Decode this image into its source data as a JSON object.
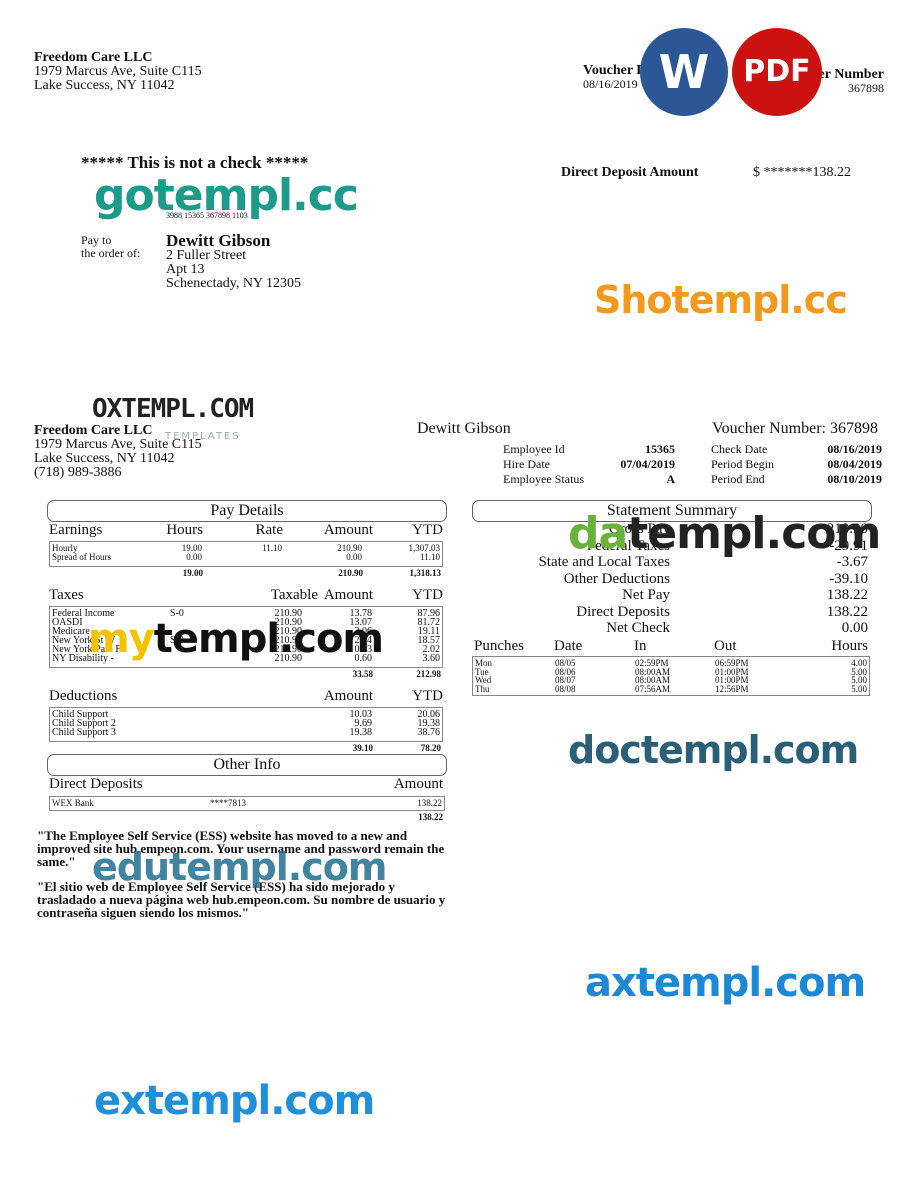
{
  "company": {
    "name": "Freedom Care LLC",
    "address1": "1979 Marcus Ave, Suite C115",
    "address2": "Lake Success, NY 11042",
    "phone": "(718) 989-3886"
  },
  "top_right": {
    "voucher_date_label": "Voucher Date",
    "voucher_date": "08/16/2019",
    "voucher_number_label": "Voucher Number",
    "voucher_number": "367898"
  },
  "check": {
    "not_a_check": "***** This is not a check *****",
    "micr": "3988 15365 367898 1103",
    "pay_to_label1": "Pay to",
    "pay_to_label2": "the order of:",
    "payee_name": "Dewitt Gibson",
    "payee_addr1": "2 Fuller Street",
    "payee_addr2": "Apt 13",
    "payee_addr3": "Schenectady, NY 12305",
    "dd_label": "Direct Deposit Amount",
    "dd_amount": "$ *******138.22"
  },
  "stub": {
    "employee_name": "Dewitt Gibson",
    "voucher_label": "Voucher Number: 367898",
    "info_left": [
      {
        "label": "Employee Id",
        "value": "15365"
      },
      {
        "label": "Hire Date",
        "value": "07/04/2019"
      },
      {
        "label": "Employee Status",
        "value": "A"
      }
    ],
    "info_right": [
      {
        "label": "Check Date",
        "value": "08/16/2019"
      },
      {
        "label": "Period Begin",
        "value": "08/04/2019"
      },
      {
        "label": "Period End",
        "value": "08/10/2019"
      }
    ]
  },
  "pay_details": {
    "title": "Pay Details",
    "earnings": {
      "headers": [
        "Earnings",
        "Hours",
        "Rate",
        "Amount",
        "YTD"
      ],
      "rows": [
        [
          "Hourly",
          "19.00",
          "11.10",
          "210.90",
          "1,307.03"
        ],
        [
          "Spread of Hours",
          "0.00",
          "",
          "0.00",
          "11.10"
        ]
      ],
      "totals": [
        "19.00",
        "210.90",
        "1,318.13"
      ]
    },
    "taxes": {
      "headers": [
        "Taxes",
        "Taxable",
        "Amount",
        "YTD"
      ],
      "rows": [
        [
          "Federal Income",
          "S-0",
          "210.90",
          "13.78",
          "87.96"
        ],
        [
          "OASDI",
          "",
          "210.90",
          "13.07",
          "81.72"
        ],
        [
          "Medicare",
          "",
          "210.90",
          "3.06",
          "19.11"
        ],
        [
          "New York St W",
          "S-0",
          "210.90",
          "2.74",
          "18.57"
        ],
        [
          "New York Paid F",
          "",
          "210.90",
          "0.33",
          "2.02"
        ],
        [
          "NY Disability -",
          "",
          "210.90",
          "0.60",
          "3.60"
        ]
      ],
      "totals": [
        "33.58",
        "212.98"
      ]
    },
    "deductions": {
      "headers": [
        "Deductions",
        "Amount",
        "YTD"
      ],
      "rows": [
        [
          "Child Support",
          "10.03",
          "20.06"
        ],
        [
          "Child Support 2",
          "9.69",
          "19.38"
        ],
        [
          "Child Support 3",
          "19.38",
          "38.76"
        ]
      ],
      "totals": [
        "39.10",
        "78.20"
      ]
    }
  },
  "other_info": {
    "title": "Other Info",
    "headers": [
      "Direct Deposits",
      "Amount"
    ],
    "rows": [
      [
        "WEX Bank",
        "****7813",
        "138.22"
      ]
    ],
    "total": "138.22"
  },
  "summary": {
    "title": "Statement Summary",
    "rows": [
      [
        "Gross Pay",
        "210.90"
      ],
      [
        "Federal Taxes",
        "-29.91"
      ],
      [
        "State and Local Taxes",
        "-3.67"
      ],
      [
        "Other Deductions",
        "-39.10"
      ],
      [
        "Net Pay",
        "138.22"
      ],
      [
        "Direct Deposits",
        "138.22"
      ],
      [
        "Net Check",
        "0.00"
      ]
    ]
  },
  "punches": {
    "headers": [
      "Punches",
      "Date",
      "In",
      "Out",
      "Hours"
    ],
    "rows": [
      [
        "Mon",
        "08/05",
        "02:59PM",
        "06:59PM",
        "4.00"
      ],
      [
        "Tue",
        "08/06",
        "08:00AM",
        "01:00PM",
        "5.00"
      ],
      [
        "Wed",
        "08/07",
        "08:00AM",
        "01:00PM",
        "5.00"
      ],
      [
        "Thu",
        "08/08",
        "07:56AM",
        "12:56PM",
        "5.00"
      ]
    ]
  },
  "notes": [
    "\"The Employee Self Service (ESS) website has moved to a new and improved site hub.empeon.com. Your username and password remain the same.\"",
    "\"El sitio web de Employee Self Service (ESS) ha sido mejorado y trasladado a nueva página web hub.empeon.com. Su nombre de usuario y contraseña siguen siendo los mismos.\""
  ],
  "watermarks": {
    "word": "W",
    "pdf": "PDF",
    "gotempl": "gotempl.cc",
    "shotempl": "Shotempl.cc",
    "oxtempl": "OXTEMPL.COM",
    "oxtempl_sub": "TEMPLATES",
    "mytempl": "mytempl.com",
    "datempl": "datempl.com",
    "doctempl": "doctempl.com",
    "edutempl": "edutempl.com",
    "axtempl": "axtempl.com",
    "extempl": "extempl.com"
  },
  "colors": {
    "word_blue": "#2b5797",
    "pdf_red": "#cc1111"
  }
}
